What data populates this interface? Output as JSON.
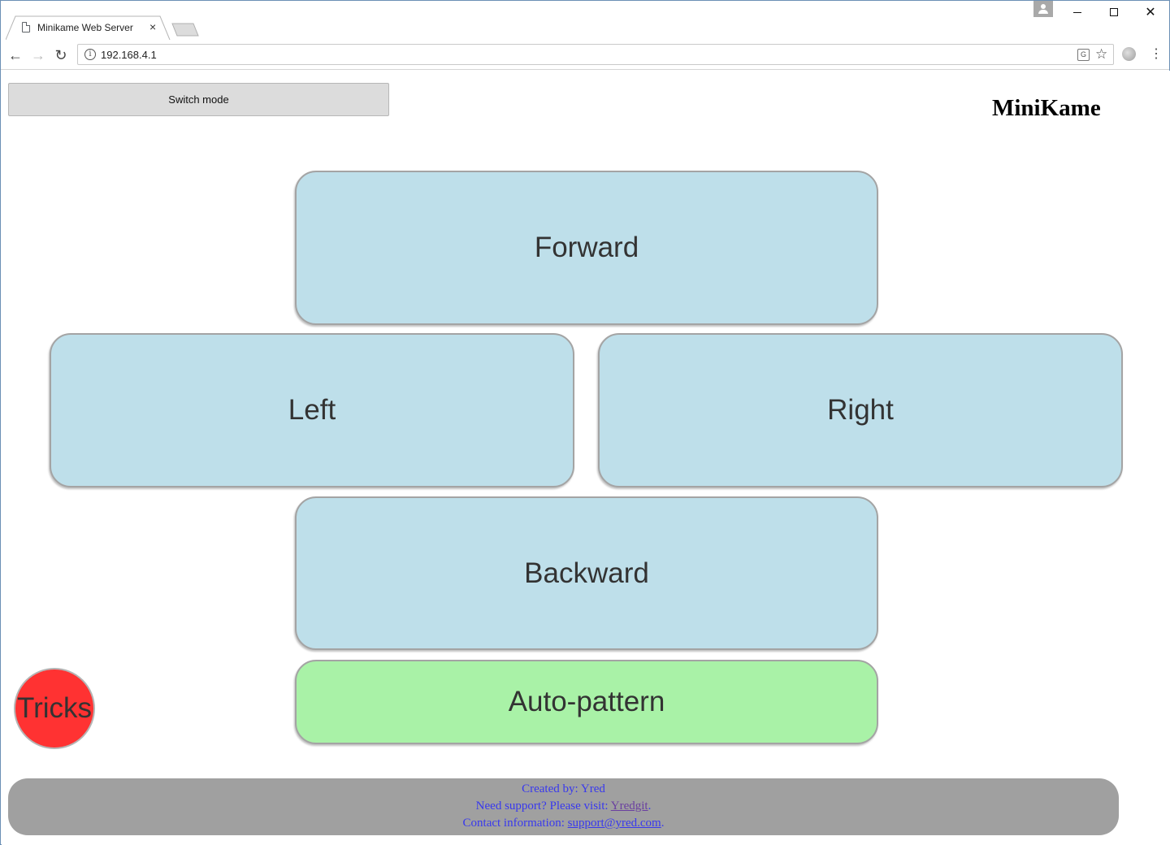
{
  "browser": {
    "tab_title": "Minikame Web Server",
    "tab_close": "×",
    "url": "192.168.4.1",
    "back": "←",
    "forward": "→",
    "reload": "↻",
    "info": "i",
    "translate": "G",
    "star": "☆",
    "menu": "⋮",
    "close": "✕"
  },
  "header": {
    "switch_mode": "Switch mode",
    "title": "MiniKame"
  },
  "controls": {
    "forward": "Forward",
    "left": "Left",
    "right": "Right",
    "backward": "Backward",
    "auto_pattern": "Auto-pattern",
    "tricks": "Tricks"
  },
  "footer": {
    "created_prefix": "Created by: ",
    "created_name": "Yred",
    "support_prefix": "Need support? Please visit: ",
    "support_link": "Yredgit",
    "support_suffix": ".",
    "contact_prefix": "Contact information: ",
    "contact_link": "support@yred.com",
    "contact_suffix": "."
  },
  "colors": {
    "direction_button": "#bedfea",
    "auto_pattern_button": "#a9f2a7",
    "tricks_button": "#ff3232",
    "footer_bg": "#a0a0a0",
    "footer_text": "#3838ee"
  }
}
